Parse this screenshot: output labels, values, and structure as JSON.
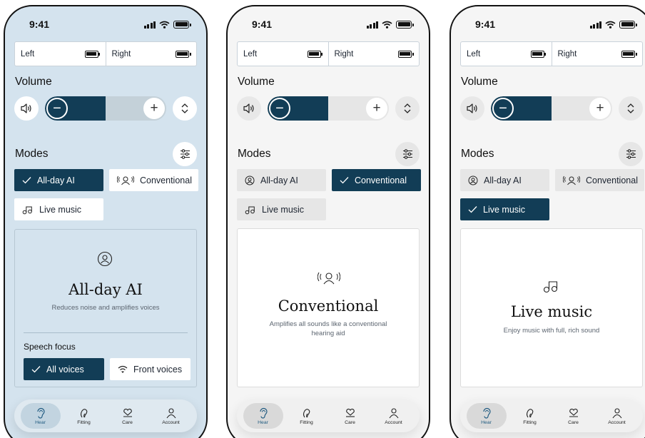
{
  "screens": [
    {
      "status_time": "9:41",
      "battery": {
        "left_label": "Left",
        "right_label": "Right"
      },
      "volume": {
        "title": "Volume",
        "level_percent": 50
      },
      "modes": {
        "title": "Modes",
        "items": [
          {
            "label": "All-day AI",
            "selected": true,
            "icon": "ai-head-icon"
          },
          {
            "label": "Conventional",
            "selected": false,
            "icon": "sound-head-icon"
          },
          {
            "label": "Live music",
            "selected": false,
            "icon": "music-note-icon"
          }
        ]
      },
      "detail": {
        "title": "All-day AI",
        "description": "Reduces noise and amplifies voices",
        "icon": "ai-head-icon"
      },
      "speech_focus": {
        "title": "Speech focus",
        "options": [
          {
            "label": "All voices",
            "selected": true
          },
          {
            "label": "Front voices",
            "selected": false,
            "icon": "front-voices-icon"
          }
        ]
      },
      "tabs": [
        {
          "label": "Hear",
          "icon": "ear-icon",
          "active": true
        },
        {
          "label": "Fitting",
          "icon": "fitting-icon",
          "active": false
        },
        {
          "label": "Care",
          "icon": "care-icon",
          "active": false
        },
        {
          "label": "Account",
          "icon": "account-icon",
          "active": false
        }
      ]
    },
    {
      "status_time": "9:41",
      "battery": {
        "left_label": "Left",
        "right_label": "Right"
      },
      "volume": {
        "title": "Volume",
        "level_percent": 50
      },
      "modes": {
        "title": "Modes",
        "items": [
          {
            "label": "All-day AI",
            "selected": false,
            "icon": "ai-head-icon"
          },
          {
            "label": "Conventional",
            "selected": true,
            "icon": "sound-head-icon"
          },
          {
            "label": "Live music",
            "selected": false,
            "icon": "music-note-icon"
          }
        ]
      },
      "detail": {
        "title": "Conventional",
        "description": "Amplifies all sounds like a conventional hearing aid",
        "icon": "sound-head-icon"
      },
      "tabs": [
        {
          "label": "Hear",
          "icon": "ear-icon",
          "active": true
        },
        {
          "label": "Fitting",
          "icon": "fitting-icon",
          "active": false
        },
        {
          "label": "Care",
          "icon": "care-icon",
          "active": false
        },
        {
          "label": "Account",
          "icon": "account-icon",
          "active": false
        }
      ]
    },
    {
      "status_time": "9:41",
      "battery": {
        "left_label": "Left",
        "right_label": "Right"
      },
      "volume": {
        "title": "Volume",
        "level_percent": 50
      },
      "modes": {
        "title": "Modes",
        "items": [
          {
            "label": "All-day AI",
            "selected": false,
            "icon": "ai-head-icon"
          },
          {
            "label": "Conventional",
            "selected": false,
            "icon": "sound-head-icon"
          },
          {
            "label": "Live music",
            "selected": true,
            "icon": "music-note-icon"
          }
        ]
      },
      "detail": {
        "title": "Live music",
        "description": "Enjoy music with full, rich sound",
        "icon": "music-note-icon"
      },
      "tabs": [
        {
          "label": "Hear",
          "icon": "ear-icon",
          "active": true
        },
        {
          "label": "Fitting",
          "icon": "fitting-icon",
          "active": false
        },
        {
          "label": "Care",
          "icon": "care-icon",
          "active": false
        },
        {
          "label": "Account",
          "icon": "account-icon",
          "active": false
        }
      ]
    }
  ],
  "colors": {
    "selected": "#123d56",
    "screen1_bg": "#d4e3ee",
    "screen_bg": "#f5f5f5",
    "active_tab_label": "#1f5a80"
  }
}
